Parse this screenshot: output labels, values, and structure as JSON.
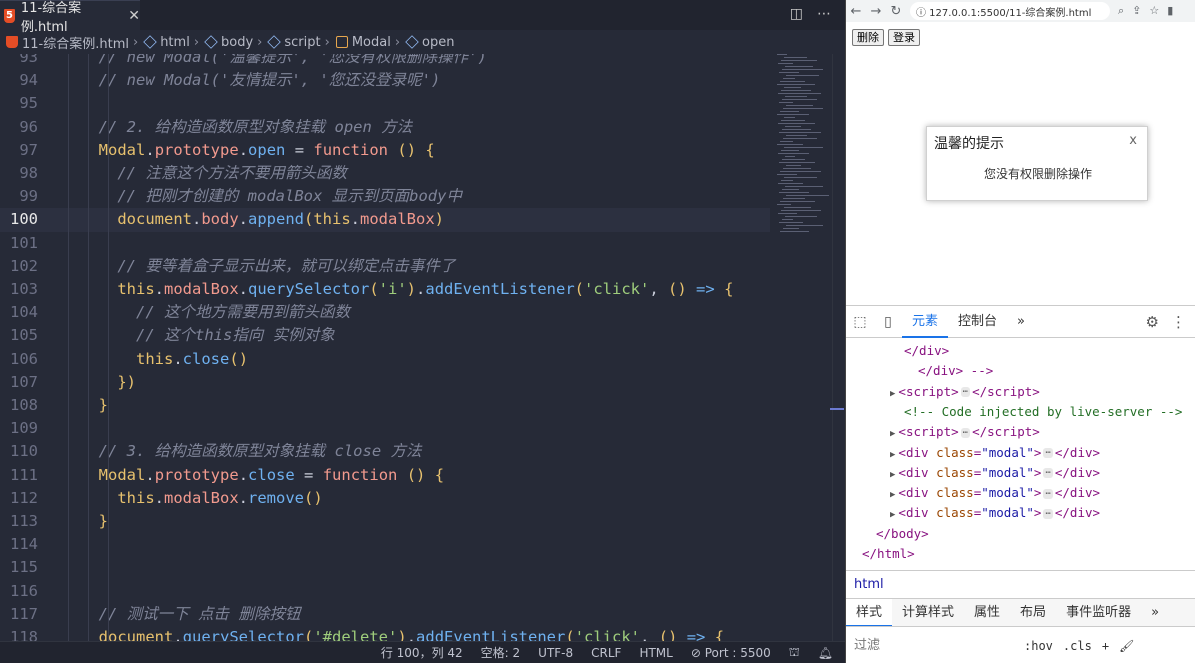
{
  "editor": {
    "tab": {
      "icon": "html5-icon",
      "title": "11-综合案例.html",
      "close": "✕"
    },
    "tab_actions": {
      "split": "◫",
      "more": "⋯"
    },
    "breadcrumb": [
      {
        "label": "11-综合案例.html",
        "icon": "html5-icon"
      },
      {
        "label": "html",
        "icon": "cube-icon"
      },
      {
        "label": "body",
        "icon": "cube-icon"
      },
      {
        "label": "script",
        "icon": "cube-icon"
      },
      {
        "label": "Modal",
        "icon": "class-icon"
      },
      {
        "label": "open",
        "icon": "cube-icon"
      }
    ],
    "current_line": 100,
    "lines": [
      {
        "n": "93",
        "t": "  // new Modal('温馨提示', '您没有权限删除操作')"
      },
      {
        "n": "94",
        "t": "  // new Modal('友情提示', '您还没登录呢')"
      },
      {
        "n": "95",
        "t": ""
      },
      {
        "n": "96",
        "t": "  // 2. 给构造函数原型对象挂载 open 方法"
      },
      {
        "n": "97",
        "t": "  Modal.prototype.open = function () {"
      },
      {
        "n": "98",
        "t": "    // 注意这个方法不要用箭头函数"
      },
      {
        "n": "99",
        "t": "    // 把刚才创建的 modalBox 显示到页面body中"
      },
      {
        "n": "100",
        "t": "    document.body.append(this.modalBox)"
      },
      {
        "n": "101",
        "t": ""
      },
      {
        "n": "102",
        "t": "    // 要等着盒子显示出来，就可以绑定点击事件了"
      },
      {
        "n": "103",
        "t": "    this.modalBox.querySelector('i').addEventListener('click', () => {"
      },
      {
        "n": "104",
        "t": "      // 这个地方需要用到箭头函数"
      },
      {
        "n": "105",
        "t": "      // 这个this指向 实例对象"
      },
      {
        "n": "106",
        "t": "      this.close()"
      },
      {
        "n": "107",
        "t": "    })"
      },
      {
        "n": "108",
        "t": "  }"
      },
      {
        "n": "109",
        "t": ""
      },
      {
        "n": "110",
        "t": "  // 3. 给构造函数原型对象挂载 close 方法"
      },
      {
        "n": "111",
        "t": "  Modal.prototype.close = function () {"
      },
      {
        "n": "112",
        "t": "    this.modalBox.remove()"
      },
      {
        "n": "113",
        "t": "  }"
      },
      {
        "n": "114",
        "t": ""
      },
      {
        "n": "115",
        "t": ""
      },
      {
        "n": "116",
        "t": ""
      },
      {
        "n": "117",
        "t": "  // 测试一下 点击 删除按钮"
      },
      {
        "n": "118",
        "t": "  document.querySelector('#delete').addEventListener('click', () => {"
      }
    ],
    "status": {
      "position": "行 100，列 42",
      "spaces": "空格: 2",
      "encoding": "UTF-8",
      "eol": "CRLF",
      "language": "HTML",
      "port": "⊘ Port : 5500",
      "icon_a": "broadcast-icon",
      "icon_b": "bell-icon"
    }
  },
  "browser": {
    "nav": {
      "back": "←",
      "forward": "→",
      "reload": "↻"
    },
    "url": "ⓘ 127.0.0.1:5500/11-综合案例.html",
    "page": {
      "buttons": {
        "delete": "删除",
        "login": "登录"
      },
      "modal": {
        "title": "温馨的提示",
        "close": "x",
        "body": "您没有权限删除操作"
      }
    },
    "devtools": {
      "tabs": {
        "elements": "元素",
        "console": "控制台",
        "more": "»"
      },
      "dom_lines": [
        {
          "indent": 3,
          "html": "</div>"
        },
        {
          "indent": 4,
          "html": "</div> -->"
        },
        {
          "indent": 2,
          "tri": true,
          "tag": "script"
        },
        {
          "indent": 3,
          "comment": "<!-- Code injected by live-server -->"
        },
        {
          "indent": 2,
          "tri": true,
          "tag": "script"
        },
        {
          "indent": 2,
          "tri": true,
          "tag": "div",
          "cls": "modal"
        },
        {
          "indent": 2,
          "tri": true,
          "tag": "div",
          "cls": "modal"
        },
        {
          "indent": 2,
          "tri": true,
          "tag": "div",
          "cls": "modal"
        },
        {
          "indent": 2,
          "tri": true,
          "tag": "div",
          "cls": "modal"
        },
        {
          "indent": 1,
          "html": "</body>"
        },
        {
          "indent": 0,
          "html": "</html>"
        }
      ],
      "crumb": "html",
      "subtabs": [
        "样式",
        "计算样式",
        "属性",
        "布局",
        "事件监听器",
        "»"
      ],
      "filter": {
        "placeholder": "过滤",
        "hov": ":hov",
        "cls": ".cls",
        "plus": "+"
      }
    }
  },
  "colors": {
    "editor_bg": "#262a37",
    "keyword": "#f29a8e",
    "string": "#9fcd7c",
    "function": "#6fb1f0",
    "comment": "#7f8498"
  }
}
